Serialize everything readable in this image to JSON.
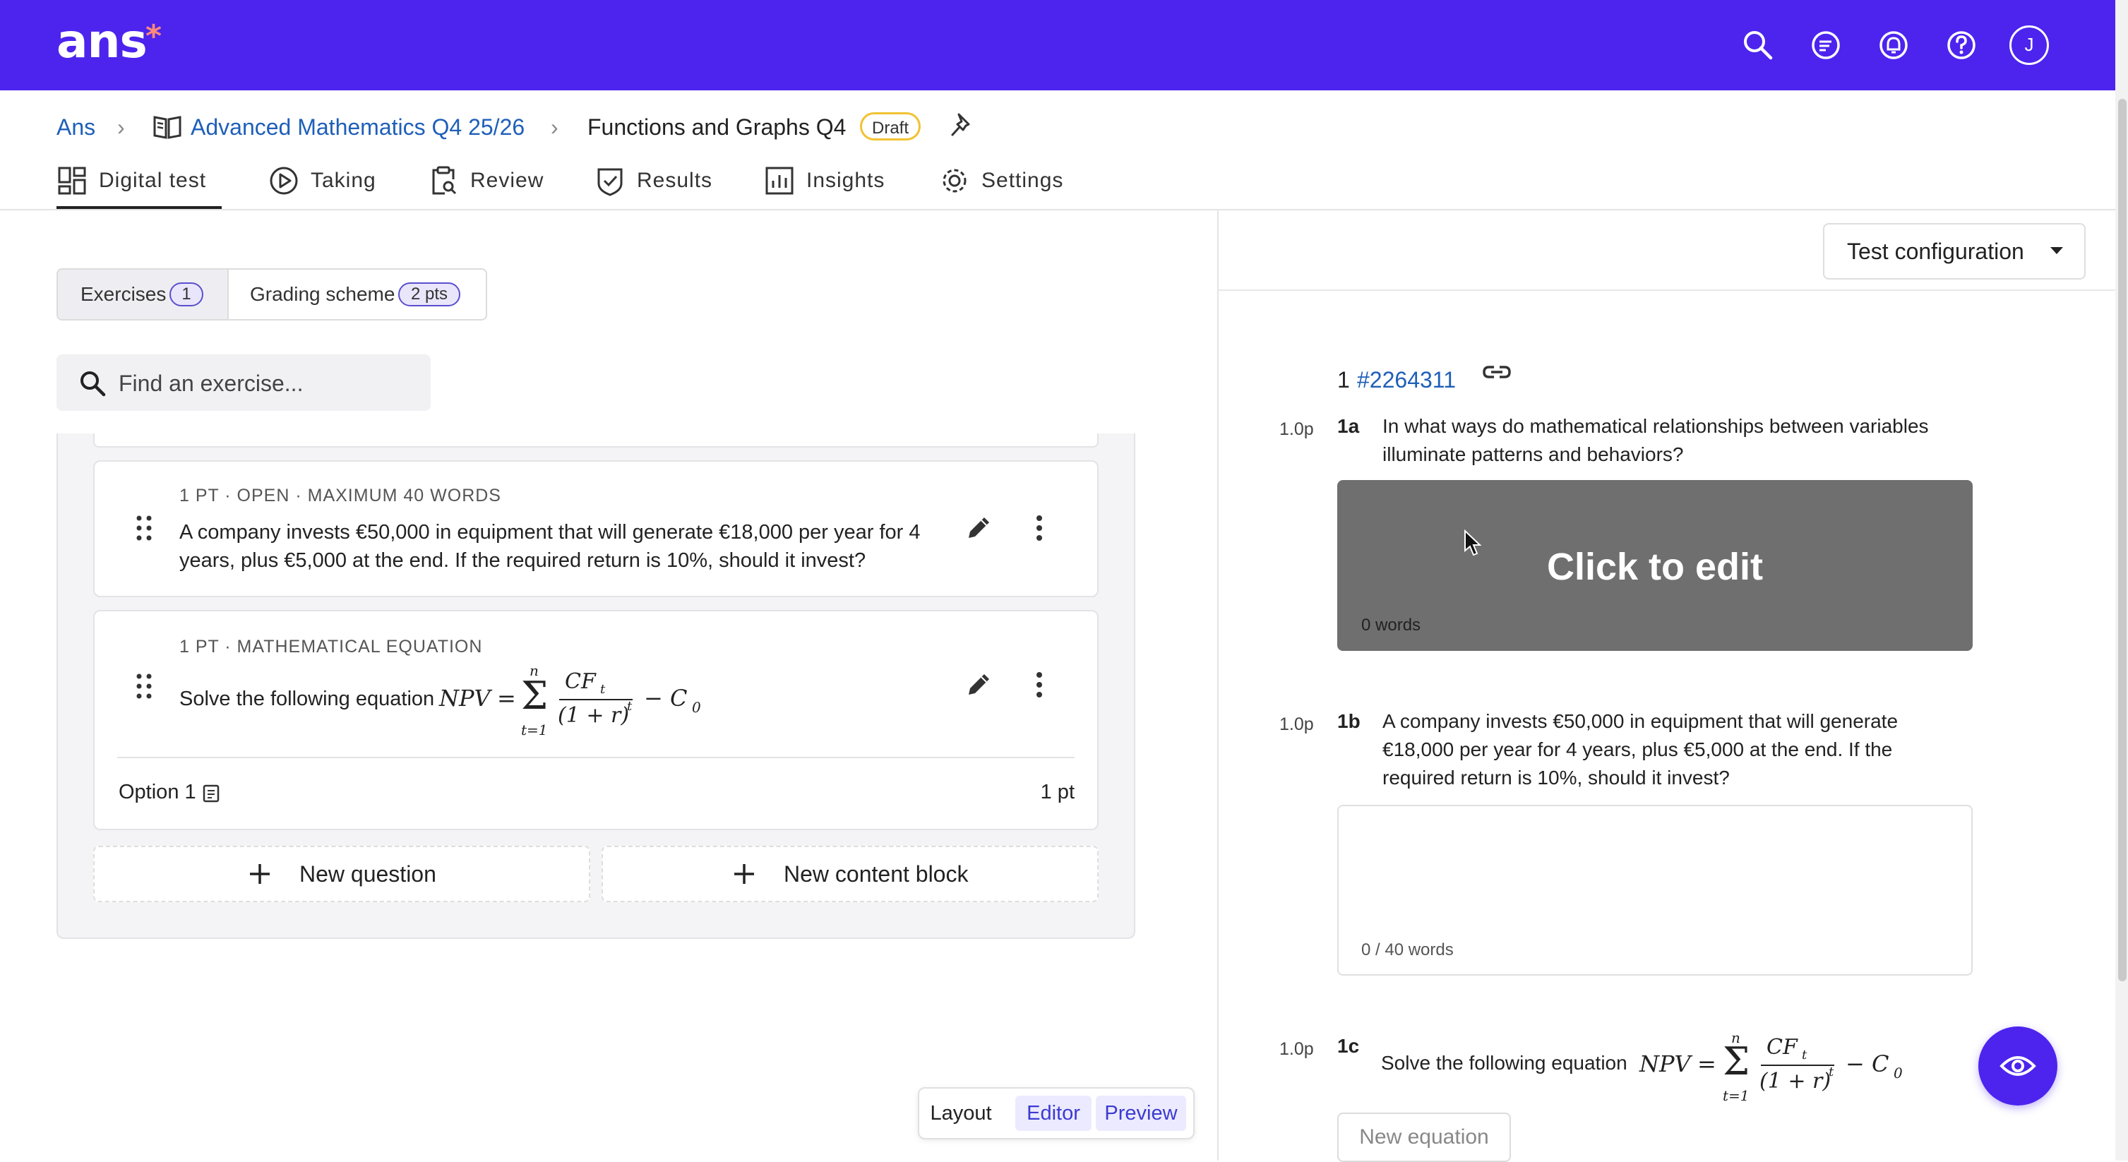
{
  "app": {
    "logo": "ans",
    "logo_mark": "*"
  },
  "topbar": {
    "icons": [
      "search-icon",
      "feedback-icon",
      "notifications-icon",
      "help-icon",
      "user-avatar-icon"
    ],
    "avatar_initial": "J"
  },
  "breadcrumb": {
    "root": "Ans",
    "course": "Advanced Mathematics Q4 25/26",
    "test": "Functions and Graphs Q4",
    "status": "Draft"
  },
  "tabs": [
    {
      "label": "Digital test",
      "active": true
    },
    {
      "label": "Taking"
    },
    {
      "label": "Review"
    },
    {
      "label": "Results"
    },
    {
      "label": "Insights"
    },
    {
      "label": "Settings"
    }
  ],
  "segment": {
    "exercises_label": "Exercises",
    "exercises_count": "1",
    "grading_label": "Grading scheme",
    "grading_count": "2 pts"
  },
  "search": {
    "placeholder": "Find an exercise..."
  },
  "questions": [
    {
      "meta": "1 PT · OPEN · MAXIMUM 40 WORDS",
      "text": "A company invests €50,000 in equipment that will generate €18,000 per year for 4 years, plus €5,000 at the end. If the required return is 10%, should it invest?"
    },
    {
      "meta": "1 PT · MATHEMATICAL EQUATION",
      "text": "Solve the following equation",
      "option_label": "Option 1",
      "option_points": "1 pt"
    }
  ],
  "equation": {
    "lhs": "NPV",
    "upper": "n",
    "lower": "t=1",
    "num": "CF",
    "num_sub": "t",
    "den": "(1 + r)",
    "den_sup": "t",
    "minus": "− C",
    "minus_sub": "0"
  },
  "actions": {
    "new_question": "New question",
    "new_content_block": "New content block"
  },
  "view_toggle": {
    "layout": "Layout",
    "editor": "Editor",
    "preview": "Preview"
  },
  "preview": {
    "config_label": "Test configuration",
    "exercise_number": "1",
    "exercise_id": "#2264311",
    "items": [
      {
        "points": "1.0p",
        "label": "1a",
        "text": "In what ways do mathematical relationships between variables illuminate patterns and behaviors?",
        "overlay": "Click to edit",
        "word_count": "0 words"
      },
      {
        "points": "1.0p",
        "label": "1b",
        "text": "A company invests €50,000 in equipment that will generate €18,000 per year for 4 years, plus €5,000 at the end. If the required return is 10%, should it invest?",
        "word_count": "0 / 40 words"
      },
      {
        "points": "1.0p",
        "label": "1c",
        "text": "Solve the following equation",
        "button": "New equation"
      }
    ]
  },
  "colors": {
    "brand": "#4c24ee",
    "draft_border": "#f1c232",
    "link": "#1f5fb8",
    "badge_border": "#5a4fcf"
  }
}
